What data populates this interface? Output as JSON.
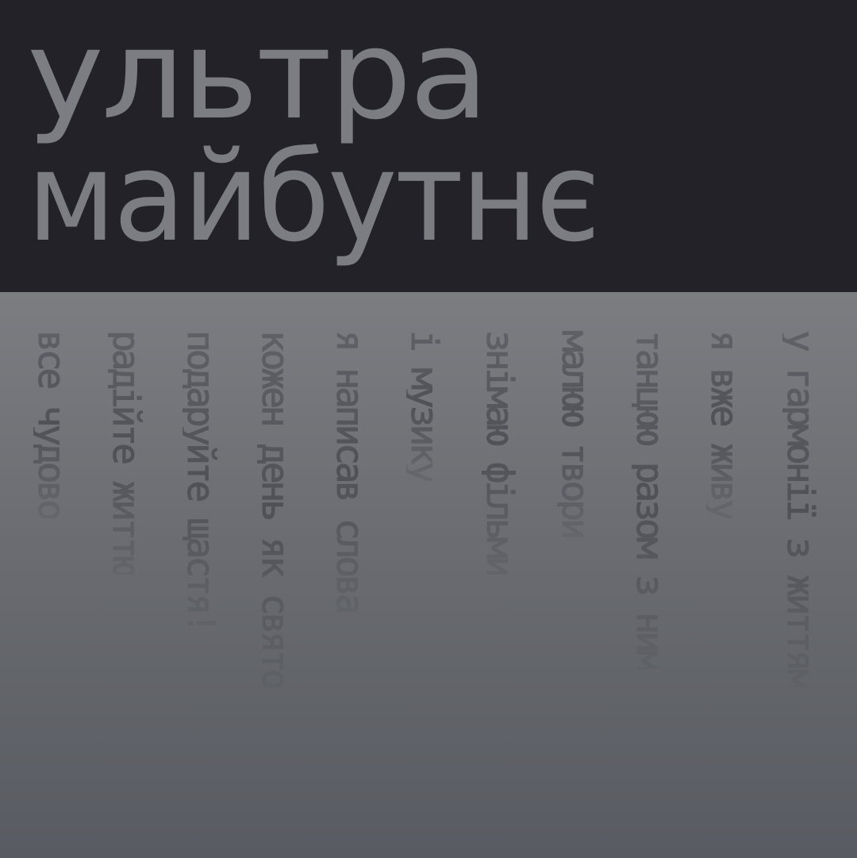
{
  "title": {
    "line1": "ультра",
    "line2": "майбутнє"
  },
  "verses": [
    "у гармонії з життям",
    "я вже живу",
    "танцюю разом з ним",
    "малюю твори",
    "знімаю фільми",
    "і музику",
    "я написав слова",
    "кожен день як свято",
    "подаруйте щастя!",
    "радійте життю",
    "все чудово"
  ],
  "colors": {
    "top_background": "#232228",
    "title_text": "#7b7d82",
    "bottom_gradient_top": "#7b7d81",
    "bottom_gradient_bottom": "#585b61",
    "verse_text": "#56585d"
  }
}
